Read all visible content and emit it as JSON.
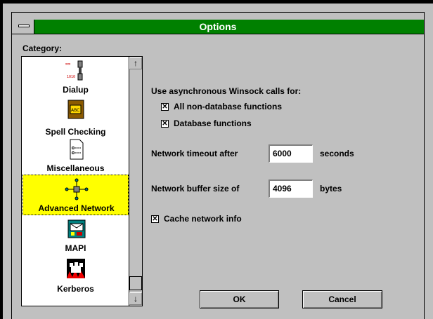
{
  "window": {
    "title": "Options"
  },
  "category_label": "Category:",
  "categories": [
    {
      "label": "Dialup",
      "icon": "modem-icon"
    },
    {
      "label": "Spell Checking",
      "icon": "abc-book-icon"
    },
    {
      "label": "Miscellaneous",
      "icon": "document-icon"
    },
    {
      "label": "Advanced Network",
      "icon": "network-icon",
      "selected": true
    },
    {
      "label": "MAPI",
      "icon": "mapi-icon"
    },
    {
      "label": "Kerberos",
      "icon": "kerberos-dog-icon"
    }
  ],
  "winsock": {
    "heading": "Use asynchronous Winsock calls for:",
    "options": [
      {
        "label": "All non-database functions",
        "checked": true
      },
      {
        "label": "Database functions",
        "checked": true
      }
    ]
  },
  "timeout": {
    "label": "Network timeout after",
    "value": "6000",
    "unit": "seconds"
  },
  "buffer": {
    "label": "Network buffer size of",
    "value": "4096",
    "unit": "bytes"
  },
  "cache": {
    "label": "Cache network info",
    "checked": true
  },
  "buttons": {
    "ok": "OK",
    "cancel": "Cancel"
  },
  "colors": {
    "titlebar": "#008000",
    "selection": "#ffff00",
    "face": "#c0c0c0"
  }
}
